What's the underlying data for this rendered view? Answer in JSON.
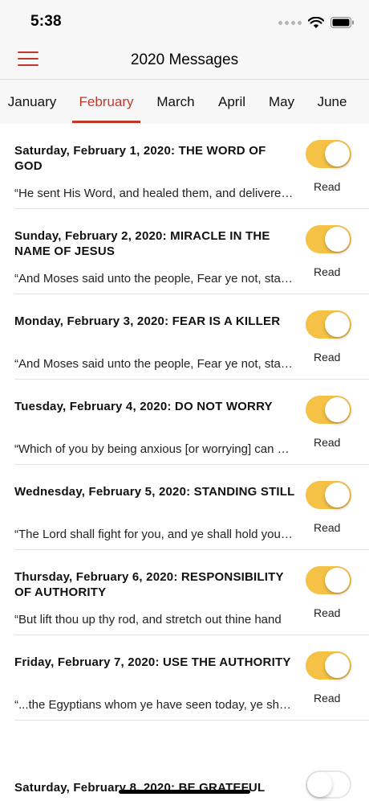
{
  "status_bar": {
    "time": "5:38"
  },
  "nav": {
    "title": "2020 Messages",
    "menu_icon": "hamburger-menu-icon"
  },
  "tabs": [
    {
      "label": "January",
      "active": false
    },
    {
      "label": "February",
      "active": true
    },
    {
      "label": "March",
      "active": false
    },
    {
      "label": "April",
      "active": false
    },
    {
      "label": "May",
      "active": false
    },
    {
      "label": "June",
      "active": false
    }
  ],
  "colors": {
    "accent": "#c0392b",
    "toggle_on": "#f5c246"
  },
  "messages": [
    {
      "title": "Saturday, February 1, 2020: THE WORD OF GOD",
      "snippet": "“He sent His Word, and healed them, and delivered them",
      "read_label": "Read",
      "read": true
    },
    {
      "title": "Sunday, February 2, 2020: MIRACLE IN THE NAME OF JESUS",
      "snippet": "“And Moses said unto the people, Fear ye not, stand still",
      "read_label": "Read",
      "read": true
    },
    {
      "title": "Monday, February 3, 2020: FEAR IS A KILLER",
      "snippet": "“And Moses said unto the people, Fear ye not, stand still",
      "read_label": "Read",
      "read": true
    },
    {
      "title": "Tuesday, February 4, 2020: DO NOT WORRY",
      "snippet": "“Which of you by being anxious [or worrying] can add",
      "read_label": "Read",
      "read": true
    },
    {
      "title": "Wednesday, February 5, 2020: STANDING STILL",
      "snippet": "“The Lord shall fight for you, and ye shall hold your peace",
      "read_label": "Read",
      "read": true
    },
    {
      "title": "Thursday, February 6, 2020: RESPONSIBILITY OF AUTHORITY",
      "snippet": "“But lift thou up thy rod, and stretch out thine hand",
      "read_label": "Read",
      "read": true
    },
    {
      "title": "Friday, February 7, 2020: USE THE AUTHORITY",
      "snippet": "“...the Egyptians whom ye have seen today, ye shall see",
      "read_label": "Read",
      "read": true
    },
    {
      "title": "Saturday, February 8, 2020: BE GRATEFUL",
      "snippet": "",
      "read_label": "",
      "read": false
    }
  ]
}
